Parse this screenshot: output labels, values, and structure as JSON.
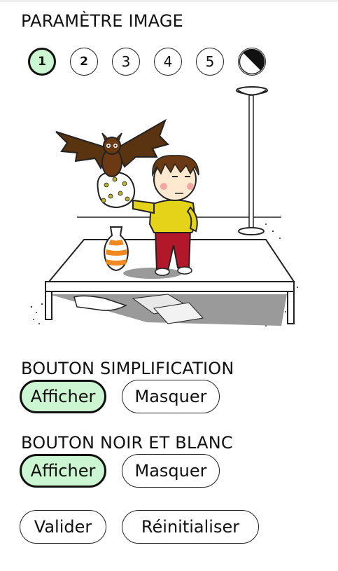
{
  "image_settings": {
    "title": "PARAMÈTRE IMAGE",
    "levels": [
      "1",
      "2",
      "3",
      "4",
      "5"
    ],
    "selected_level": "1"
  },
  "simplification": {
    "title": "BOUTON SIMPLIFICATION",
    "show_label": "Afficher",
    "hide_label": "Masquer",
    "selected": "Afficher"
  },
  "black_white": {
    "title": "BOUTON NOIR ET BLANC",
    "show_label": "Afficher",
    "hide_label": "Masquer",
    "selected": "Afficher"
  },
  "actions": {
    "validate_label": "Valider",
    "reset_label": "Réinitialiser"
  },
  "colors": {
    "active_fill": "#ccf5d1",
    "border": "#111111",
    "background": "#ffffff"
  }
}
